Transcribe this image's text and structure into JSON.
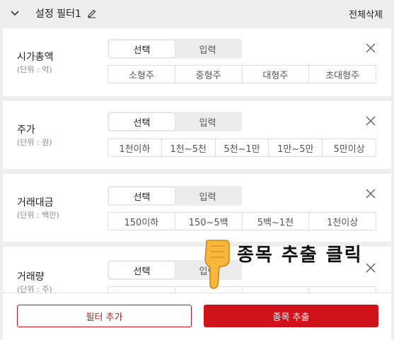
{
  "header": {
    "title": "설정 필터1",
    "clear_all": "전체삭제"
  },
  "filters": [
    {
      "label": "시가총액",
      "unit": "(단위 : 억)",
      "toggle": [
        "선택",
        "입력"
      ],
      "options": [
        "소형주",
        "중형주",
        "대형주",
        "초대형주"
      ]
    },
    {
      "label": "주가",
      "unit": "(단위 : 원)",
      "toggle": [
        "선택",
        "입력"
      ],
      "options": [
        "1천이하",
        "1천~5천",
        "5천~1만",
        "1만~5만",
        "5만이상"
      ]
    },
    {
      "label": "거래대금",
      "unit": "(단위 : 백만)",
      "toggle": [
        "선택",
        "입력"
      ],
      "options": [
        "150이하",
        "150~5백",
        "5백~1천",
        "1천이상"
      ]
    },
    {
      "label": "거래량",
      "unit": "(단위 : 주)",
      "toggle": [
        "선택",
        "입력"
      ],
      "options": [
        "",
        "",
        "",
        ""
      ]
    }
  ],
  "buttons": {
    "add_filter": "필터 추가",
    "extract": "종목 추출"
  },
  "annotation": {
    "text": "종목 추출 클릭",
    "icon": "pointing-down-hand-icon"
  },
  "colors": {
    "accent": "#d0121b",
    "background": "#eeeeee"
  }
}
